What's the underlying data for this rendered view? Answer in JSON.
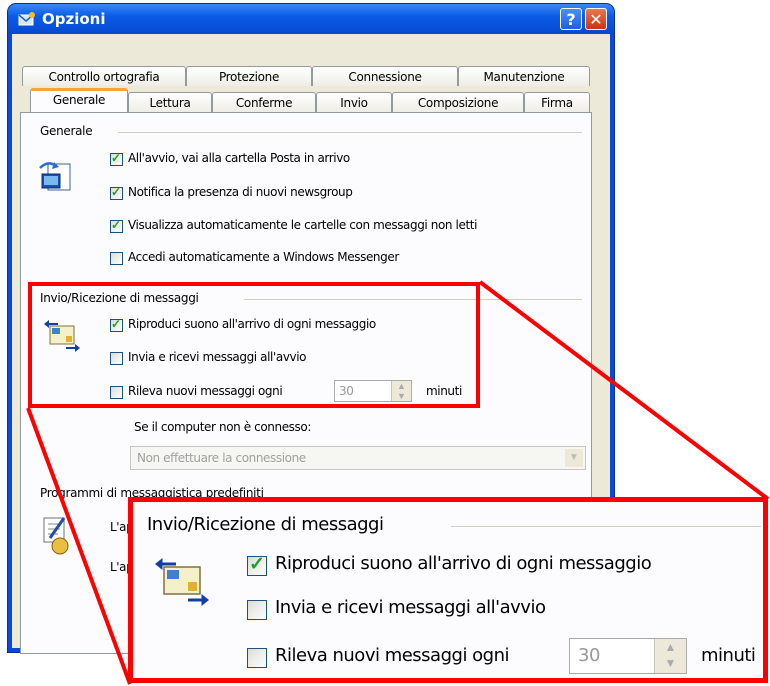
{
  "window": {
    "title": "Opzioni",
    "help": "?",
    "close": "✕"
  },
  "tabs_top": [
    "Controllo ortografia",
    "Protezione",
    "Connessione",
    "Manutenzione"
  ],
  "tabs_bottom": [
    "Generale",
    "Lettura",
    "Conferme",
    "Invio",
    "Composizione",
    "Firma"
  ],
  "active_tab": "Generale",
  "general": {
    "heading": "Generale",
    "options": [
      {
        "label": "All'avvio, vai alla cartella Posta in arrivo",
        "checked": true
      },
      {
        "label": "Notifica la presenza di nuovi newsgroup",
        "checked": true
      },
      {
        "label": "Visualizza automaticamente le cartelle con messaggi non letti",
        "checked": true
      },
      {
        "label": "Accedi automaticamente a Windows Messenger",
        "checked": false
      }
    ]
  },
  "send_receive": {
    "heading": "Invio/Ricezione di messaggi",
    "options": [
      {
        "label": "Riproduci suono all'arrivo di ogni messaggio",
        "checked": true
      },
      {
        "label": "Invia e ricevi messaggi all'avvio",
        "checked": false
      },
      {
        "label": "Rileva nuovi messaggi ogni",
        "checked": false
      }
    ],
    "interval_value": "30",
    "interval_unit": "minuti",
    "offline_label": "Se il computer non è connesso:",
    "offline_select": "Non effettuare la connessione"
  },
  "default_programs": {
    "heading": "Programmi di messaggistica predefiniti",
    "line1": "L'ap",
    "line2": "L'ap"
  },
  "colors": {
    "highlight": "#ff0000",
    "titlebar": "#0a5ce8",
    "dialog_bg": "#ece9d8"
  }
}
